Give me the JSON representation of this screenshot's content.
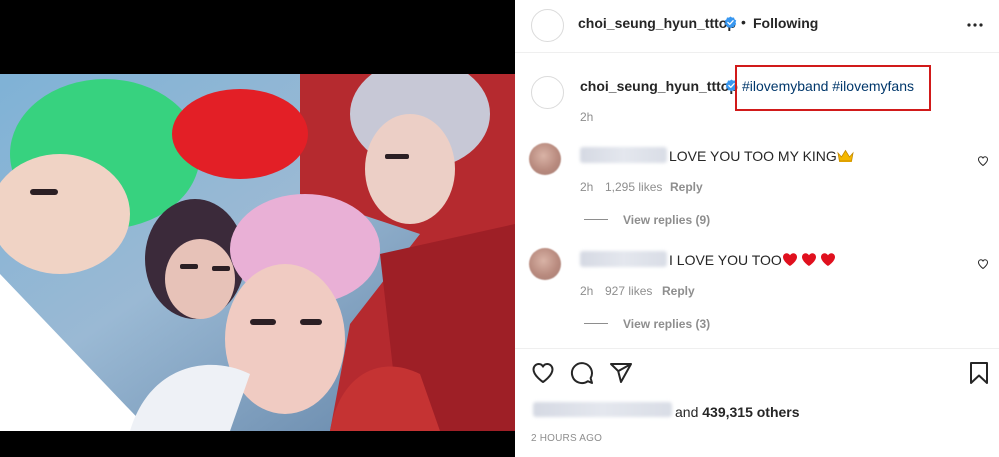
{
  "post": {
    "author": "choi_seung_hyun_tttop",
    "follow_separator": "•",
    "follow_status": "Following",
    "caption": {
      "author": "choi_seung_hyun_tttop",
      "hashtags": "#ilovemyband #ilovemyfans",
      "time": "2h"
    },
    "comments": [
      {
        "text": "LOVE YOU TOO MY KING",
        "emoji": "crown",
        "time": "2h",
        "likes": "1,295 likes",
        "reply_label": "Reply",
        "view_replies": "View replies (9)"
      },
      {
        "text": "I LOVE YOU TOO",
        "emoji": "hearts",
        "time": "2h",
        "likes": "927 likes",
        "reply_label": "Reply",
        "view_replies": "View replies (3)"
      }
    ],
    "likes": {
      "prefix_blurred": "",
      "text_and": "and",
      "count": "439,315 others"
    },
    "timestamp": "2 HOURS AGO",
    "icons": [
      "verified-badge-icon",
      "more-options-icon",
      "heart-icon",
      "comment-icon",
      "share-icon",
      "bookmark-icon"
    ],
    "colors": {
      "link": "#00376b",
      "highlight_box": "#d11a1a",
      "verified": "#3897f0",
      "heart": "#e0101e"
    }
  }
}
